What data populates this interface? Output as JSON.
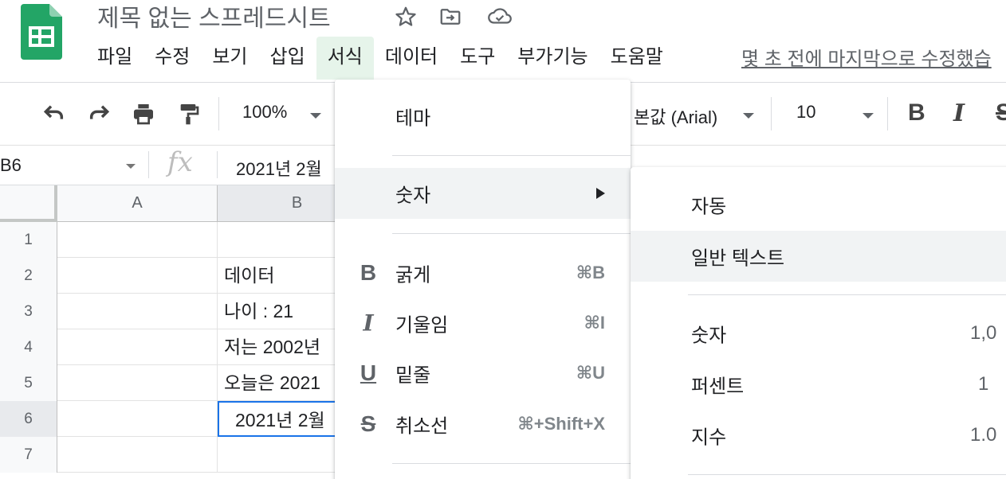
{
  "document": {
    "title": "제목 없는 스프레드시트"
  },
  "menubar": {
    "items": [
      "파일",
      "수정",
      "보기",
      "삽입",
      "서식",
      "데이터",
      "도구",
      "부가기능",
      "도움말"
    ],
    "active_index": 4,
    "last_edit": "몇 초 전에 마지막으로 수정했습"
  },
  "toolbar": {
    "zoom": "100%",
    "font": "본값 (Arial)",
    "font_size": "10",
    "bold": "B",
    "italic": "I",
    "strike": "S"
  },
  "formula_bar": {
    "name_box": "B6",
    "fx": "fx",
    "value": "2021년 2월"
  },
  "grid": {
    "columns": [
      "A",
      "B"
    ],
    "selected_column": "B",
    "selected_row": 6,
    "rows": [
      {
        "num": "1",
        "a": "",
        "b": ""
      },
      {
        "num": "2",
        "a": "",
        "b": "데이터"
      },
      {
        "num": "3",
        "a": "",
        "b": "나이 : 21"
      },
      {
        "num": "4",
        "a": "",
        "b": "저는 2002년"
      },
      {
        "num": "5",
        "a": "",
        "b": "오늘은 2021"
      },
      {
        "num": "6",
        "a": "",
        "b": "2021년 2월"
      },
      {
        "num": "7",
        "a": "",
        "b": ""
      }
    ]
  },
  "format_menu": {
    "theme": "테마",
    "number": "숫자",
    "bold": {
      "icon": "B",
      "label": "굵게",
      "shortcut": "⌘B"
    },
    "italic": {
      "icon": "I",
      "label": "기울임",
      "shortcut": "⌘I"
    },
    "underline": {
      "icon": "U",
      "label": "밑줄",
      "shortcut": "⌘U"
    },
    "strikethrough": {
      "icon": "S",
      "label": "취소선",
      "shortcut": "⌘+Shift+X"
    }
  },
  "number_submenu": {
    "auto": "자동",
    "plain_text": "일반 텍스트",
    "number": {
      "label": "숫자",
      "example": "1,0"
    },
    "percent": {
      "label": "퍼센트",
      "example": "1"
    },
    "scientific": {
      "label": "지수",
      "example": "1.0"
    }
  },
  "colors": {
    "accent": "#1a73e8",
    "sheets_green": "#23a566",
    "menu_active": "#e6f4ea"
  }
}
